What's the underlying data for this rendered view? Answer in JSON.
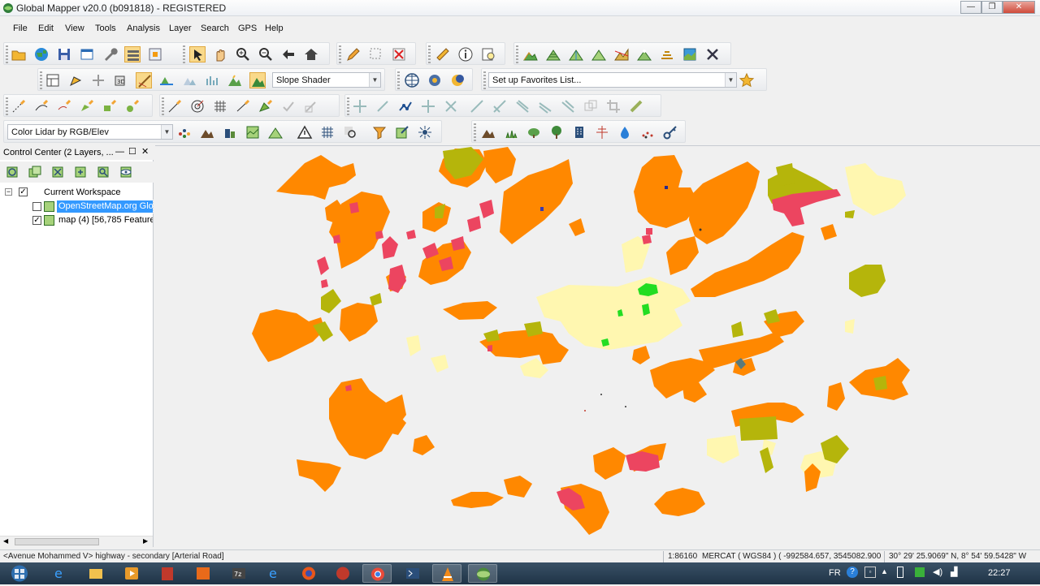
{
  "window": {
    "title": "Global Mapper v20.0 (b091818) - REGISTERED",
    "minimize": "—",
    "maximize": "❐",
    "close": "✕"
  },
  "menu": [
    "File",
    "Edit",
    "View",
    "Tools",
    "Analysis",
    "Layer",
    "Search",
    "GPS",
    "Help"
  ],
  "toolbar": {
    "shader_select": "Slope Shader",
    "favorites_select": "Set up Favorites List...",
    "lidar_select": "Color Lidar by RGB/Elev"
  },
  "control_center": {
    "title": "Control Center (2 Layers, ...",
    "workspace": "Current Workspace",
    "layers": [
      {
        "label": "OpenStreetMap.org Glo",
        "checked": false,
        "selected": true
      },
      {
        "label": "map (4) [56,785 Feature",
        "checked": true,
        "selected": false
      }
    ]
  },
  "status": {
    "feature": "<Avenue Mohammed V> highway - secondary [Arterial Road]",
    "scale": "1:86160",
    "projection": "MERCAT ( WGS84 ) ( -992584.657, 3545082.900 )",
    "coords": "30° 29' 25.9069\" N, 8° 54' 59.5428\" W"
  },
  "taskbar": {
    "lang": "FR",
    "time": "22:27"
  },
  "colors": {
    "orange": "#ff8800",
    "olive": "#b5b50b",
    "pale_yellow": "#fff7b0",
    "red": "#ec4560",
    "green": "#22dd22"
  }
}
